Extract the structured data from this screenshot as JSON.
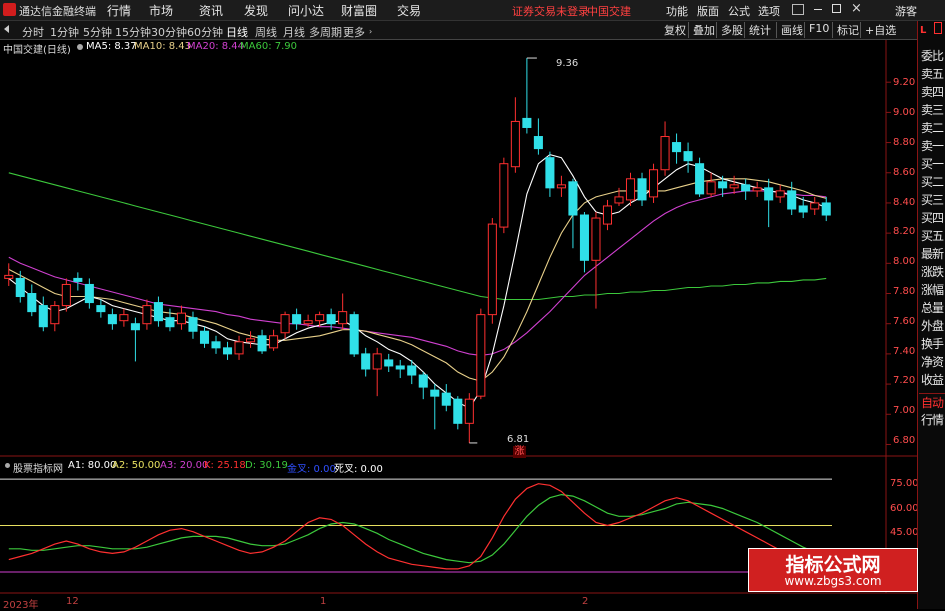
{
  "app": {
    "title": "通达信金融终端"
  },
  "menu": [
    "行情",
    "市场",
    "资讯",
    "发现",
    "问小达",
    "财富圈",
    "交易"
  ],
  "warning": {
    "trading": "证券交易未登录",
    "stock": "中国交建"
  },
  "menu_right": [
    "功能",
    "版面",
    "公式",
    "选项"
  ],
  "account": {
    "label": "游客"
  },
  "periods": [
    "分时",
    "1分钟",
    "5分钟",
    "15分钟",
    "30分钟",
    "60分钟",
    "日线",
    "周线",
    "月线",
    "多周期",
    "更多"
  ],
  "active_period": "日线",
  "toolbar": [
    "复权",
    "叠加",
    "多股",
    "统计",
    "画线",
    "F10",
    "标记",
    "+自选"
  ],
  "stock_label": "中国交建(日线)",
  "ma": [
    {
      "label": "MA5: 8.37",
      "color": "#ffffff"
    },
    {
      "label": "MA10: 8.43",
      "color": "#e8d08a"
    },
    {
      "label": "MA20: 8.44",
      "color": "#d040d0"
    },
    {
      "label": "MA60: 7.90",
      "color": "#3cc83c"
    }
  ],
  "price_axis": [
    "9.20",
    "9.00",
    "8.80",
    "8.60",
    "8.40",
    "8.20",
    "8.00",
    "7.80",
    "7.60",
    "7.40",
    "7.20",
    "7.00",
    "6.80"
  ],
  "high_marker": "9.36",
  "low_marker": "6.81",
  "low_flag": "涨",
  "indicator": {
    "name": "股票指标网",
    "items": [
      {
        "label": "A1: 80.00",
        "color": "#ffffff"
      },
      {
        "label": "A2: 50.00",
        "color": "#e8e060"
      },
      {
        "label": "A3: 20.00",
        "color": "#d040d0"
      },
      {
        "label": "K: 25.18",
        "color": "#ff3030"
      },
      {
        "label": "D: 30.19",
        "color": "#3cc83c"
      },
      {
        "label": "金叉: 0.00",
        "color": "#3050ff"
      },
      {
        "label": "死叉: 0.00",
        "color": "#ffffff"
      }
    ],
    "axis": [
      "75.00",
      "60.00",
      "45.00"
    ]
  },
  "dates": [
    "2023年",
    "12",
    "1",
    "2"
  ],
  "right_panel": {
    "top": "L",
    "items": [
      "委比",
      "卖五",
      "卖四",
      "卖三",
      "卖二",
      "卖一",
      "买一",
      "买二",
      "买三",
      "买四",
      "买五",
      "最新",
      "涨跌",
      "涨幅",
      "总量",
      "外盘",
      "换手",
      "净资",
      "收益"
    ],
    "tabs": [
      "自动",
      "行情"
    ]
  },
  "watermark": {
    "title": "指标公式网",
    "url": "www.zbgs3.com"
  },
  "chart_data": {
    "type": "candlestick",
    "title": "中国交建(日线)",
    "ylim": [
      6.75,
      9.4
    ],
    "last": {
      "MA5": 8.37,
      "MA10": 8.43,
      "MA20": 8.44,
      "MA60": 7.9
    },
    "high": 9.36,
    "low": 6.81,
    "candles": [
      [
        7.9,
        7.92,
        8.0,
        7.85
      ],
      [
        7.9,
        7.78,
        7.95,
        7.74
      ],
      [
        7.8,
        7.68,
        7.86,
        7.65
      ],
      [
        7.72,
        7.58,
        7.78,
        7.55
      ],
      [
        7.6,
        7.72,
        7.75,
        7.55
      ],
      [
        7.72,
        7.86,
        7.9,
        7.68
      ],
      [
        7.9,
        7.88,
        7.94,
        7.82
      ],
      [
        7.86,
        7.74,
        7.9,
        7.7
      ],
      [
        7.72,
        7.68,
        7.76,
        7.64
      ],
      [
        7.66,
        7.6,
        7.7,
        7.56
      ],
      [
        7.62,
        7.66,
        7.7,
        7.58
      ],
      [
        7.6,
        7.56,
        7.64,
        7.35
      ],
      [
        7.6,
        7.72,
        7.76,
        7.56
      ],
      [
        7.74,
        7.62,
        7.78,
        7.58
      ],
      [
        7.64,
        7.58,
        7.7,
        7.55
      ],
      [
        7.6,
        7.67,
        7.72,
        7.56
      ],
      [
        7.64,
        7.55,
        7.68,
        7.5
      ],
      [
        7.55,
        7.47,
        7.58,
        7.44
      ],
      [
        7.48,
        7.44,
        7.52,
        7.4
      ],
      [
        7.44,
        7.4,
        7.48,
        7.36
      ],
      [
        7.4,
        7.48,
        7.52,
        7.36
      ],
      [
        7.48,
        7.5,
        7.55,
        7.44
      ],
      [
        7.52,
        7.42,
        7.56,
        7.4
      ],
      [
        7.44,
        7.52,
        7.56,
        7.42
      ],
      [
        7.54,
        7.66,
        7.68,
        7.5
      ],
      [
        7.66,
        7.6,
        7.7,
        7.56
      ],
      [
        7.6,
        7.62,
        7.66,
        7.58
      ],
      [
        7.62,
        7.66,
        7.68,
        7.58
      ],
      [
        7.66,
        7.6,
        7.7,
        7.56
      ],
      [
        7.6,
        7.68,
        7.8,
        7.56
      ],
      [
        7.66,
        7.4,
        7.68,
        7.38
      ],
      [
        7.4,
        7.3,
        7.44,
        7.25
      ],
      [
        7.3,
        7.4,
        7.44,
        7.12
      ],
      [
        7.36,
        7.32,
        7.4,
        7.28
      ],
      [
        7.32,
        7.3,
        7.36,
        7.24
      ],
      [
        7.32,
        7.26,
        7.36,
        7.2
      ],
      [
        7.26,
        7.18,
        7.28,
        7.1
      ],
      [
        7.16,
        7.12,
        7.2,
        6.9
      ],
      [
        7.14,
        7.06,
        7.2,
        7.02
      ],
      [
        7.1,
        6.94,
        7.12,
        6.9
      ],
      [
        6.94,
        7.1,
        7.14,
        6.81
      ],
      [
        7.12,
        7.66,
        7.7,
        7.1
      ],
      [
        7.66,
        8.26,
        8.3,
        7.6
      ],
      [
        8.24,
        8.66,
        8.7,
        8.2
      ],
      [
        8.64,
        8.94,
        9.1,
        8.6
      ],
      [
        8.96,
        8.9,
        9.36,
        8.86
      ],
      [
        8.84,
        8.76,
        8.96,
        8.72
      ],
      [
        8.7,
        8.5,
        8.74,
        8.44
      ],
      [
        8.5,
        8.52,
        8.58,
        8.44
      ],
      [
        8.54,
        8.32,
        8.56,
        8.1
      ],
      [
        8.32,
        8.02,
        8.34,
        7.94
      ],
      [
        8.02,
        8.3,
        8.34,
        7.7
      ],
      [
        8.26,
        8.38,
        8.42,
        8.22
      ],
      [
        8.4,
        8.44,
        8.5,
        8.38
      ],
      [
        8.42,
        8.56,
        8.6,
        8.38
      ],
      [
        8.56,
        8.42,
        8.6,
        8.38
      ],
      [
        8.44,
        8.62,
        8.66,
        8.4
      ],
      [
        8.62,
        8.84,
        8.94,
        8.58
      ],
      [
        8.8,
        8.74,
        8.86,
        8.66
      ],
      [
        8.74,
        8.68,
        8.8,
        8.6
      ],
      [
        8.66,
        8.46,
        8.7,
        8.44
      ],
      [
        8.46,
        8.54,
        8.6,
        8.44
      ],
      [
        8.54,
        8.5,
        8.58,
        8.44
      ],
      [
        8.5,
        8.52,
        8.58,
        8.46
      ],
      [
        8.52,
        8.48,
        8.56,
        8.42
      ],
      [
        8.48,
        8.5,
        8.54,
        8.44
      ],
      [
        8.5,
        8.42,
        8.56,
        8.24
      ],
      [
        8.44,
        8.48,
        8.52,
        8.4
      ],
      [
        8.48,
        8.36,
        8.54,
        8.32
      ],
      [
        8.38,
        8.34,
        8.44,
        8.3
      ],
      [
        8.36,
        8.4,
        8.44,
        8.32
      ],
      [
        8.4,
        8.32,
        8.44,
        8.28
      ]
    ],
    "ma5": [
      7.9,
      7.84,
      7.78,
      7.72,
      7.68,
      7.7,
      7.74,
      7.78,
      7.76,
      7.72,
      7.7,
      7.68,
      7.66,
      7.64,
      7.62,
      7.62,
      7.6,
      7.58,
      7.55,
      7.5,
      7.48,
      7.47,
      7.46,
      7.46,
      7.5,
      7.54,
      7.57,
      7.59,
      7.61,
      7.62,
      7.58,
      7.52,
      7.48,
      7.43,
      7.4,
      7.35,
      7.28,
      7.2,
      7.14,
      7.08,
      7.04,
      7.16,
      7.4,
      7.72,
      8.08,
      8.46,
      8.66,
      8.72,
      8.7,
      8.58,
      8.44,
      8.34,
      8.32,
      8.34,
      8.4,
      8.44,
      8.5,
      8.56,
      8.62,
      8.66,
      8.64,
      8.6,
      8.56,
      8.54,
      8.52,
      8.5,
      8.48,
      8.47,
      8.45,
      8.42,
      8.4,
      8.37
    ],
    "ma10": [
      7.96,
      7.92,
      7.88,
      7.84,
      7.8,
      7.78,
      7.78,
      7.78,
      7.77,
      7.76,
      7.74,
      7.72,
      7.7,
      7.68,
      7.67,
      7.66,
      7.64,
      7.62,
      7.6,
      7.57,
      7.54,
      7.52,
      7.5,
      7.49,
      7.49,
      7.5,
      7.51,
      7.52,
      7.54,
      7.56,
      7.56,
      7.55,
      7.53,
      7.51,
      7.49,
      7.46,
      7.42,
      7.38,
      7.34,
      7.28,
      7.24,
      7.22,
      7.28,
      7.38,
      7.52,
      7.68,
      7.86,
      8.04,
      8.2,
      8.32,
      8.4,
      8.44,
      8.46,
      8.48,
      8.48,
      8.48,
      8.48,
      8.48,
      8.5,
      8.52,
      8.54,
      8.55,
      8.56,
      8.56,
      8.56,
      8.55,
      8.54,
      8.52,
      8.5,
      8.48,
      8.45,
      8.43
    ],
    "ma20": [
      8.04,
      8.0,
      7.97,
      7.94,
      7.91,
      7.89,
      7.87,
      7.85,
      7.83,
      7.81,
      7.79,
      7.77,
      7.75,
      7.73,
      7.72,
      7.71,
      7.7,
      7.69,
      7.68,
      7.66,
      7.65,
      7.63,
      7.62,
      7.61,
      7.6,
      7.6,
      7.59,
      7.58,
      7.58,
      7.57,
      7.56,
      7.55,
      7.54,
      7.53,
      7.52,
      7.51,
      7.49,
      7.47,
      7.45,
      7.42,
      7.4,
      7.39,
      7.4,
      7.43,
      7.48,
      7.54,
      7.61,
      7.68,
      7.76,
      7.84,
      7.92,
      7.98,
      8.04,
      8.1,
      8.16,
      8.22,
      8.28,
      8.33,
      8.37,
      8.4,
      8.42,
      8.44,
      8.46,
      8.47,
      8.48,
      8.48,
      8.48,
      8.47,
      8.46,
      8.45,
      8.45,
      8.44
    ],
    "ma60": [
      8.6,
      8.58,
      8.56,
      8.54,
      8.52,
      8.5,
      8.48,
      8.46,
      8.44,
      8.42,
      8.4,
      8.38,
      8.36,
      8.34,
      8.32,
      8.3,
      8.28,
      8.26,
      8.24,
      8.22,
      8.2,
      8.18,
      8.16,
      8.14,
      8.12,
      8.1,
      8.08,
      8.06,
      8.04,
      8.02,
      8.0,
      7.98,
      7.96,
      7.94,
      7.92,
      7.9,
      7.88,
      7.86,
      7.84,
      7.82,
      7.8,
      7.78,
      7.77,
      7.76,
      7.76,
      7.76,
      7.76,
      7.77,
      7.78,
      7.78,
      7.79,
      7.79,
      7.8,
      7.8,
      7.81,
      7.81,
      7.82,
      7.82,
      7.83,
      7.84,
      7.84,
      7.85,
      7.85,
      7.86,
      7.86,
      7.87,
      7.87,
      7.88,
      7.88,
      7.89,
      7.89,
      7.9
    ],
    "indicator_ylim": [
      20,
      82
    ],
    "levels": {
      "A1": 80,
      "A2": 50,
      "A3": 20
    },
    "K": [
      28,
      30,
      32,
      35,
      38,
      40,
      38,
      35,
      33,
      32,
      33,
      36,
      40,
      44,
      47,
      48,
      46,
      43,
      40,
      37,
      34,
      32,
      33,
      36,
      40,
      46,
      52,
      55,
      54,
      50,
      44,
      38,
      33,
      29,
      27,
      25,
      24,
      23,
      22,
      22,
      24,
      30,
      42,
      56,
      67,
      74,
      77,
      76,
      72,
      65,
      58,
      52,
      50,
      52,
      55,
      58,
      62,
      66,
      68,
      66,
      62,
      58,
      54,
      50,
      46,
      42,
      38,
      34,
      31,
      28,
      26,
      25
    ],
    "D": [
      35,
      35,
      34,
      34,
      35,
      36,
      37,
      37,
      36,
      35,
      35,
      35,
      36,
      38,
      40,
      42,
      43,
      43,
      43,
      42,
      40,
      38,
      37,
      37,
      38,
      41,
      44,
      48,
      51,
      52,
      51,
      48,
      45,
      41,
      38,
      35,
      32,
      30,
      28,
      27,
      26,
      27,
      31,
      38,
      47,
      56,
      63,
      68,
      70,
      69,
      66,
      62,
      58,
      56,
      56,
      57,
      59,
      61,
      64,
      65,
      64,
      63,
      61,
      58,
      55,
      52,
      48,
      44,
      40,
      36,
      33,
      30
    ]
  }
}
